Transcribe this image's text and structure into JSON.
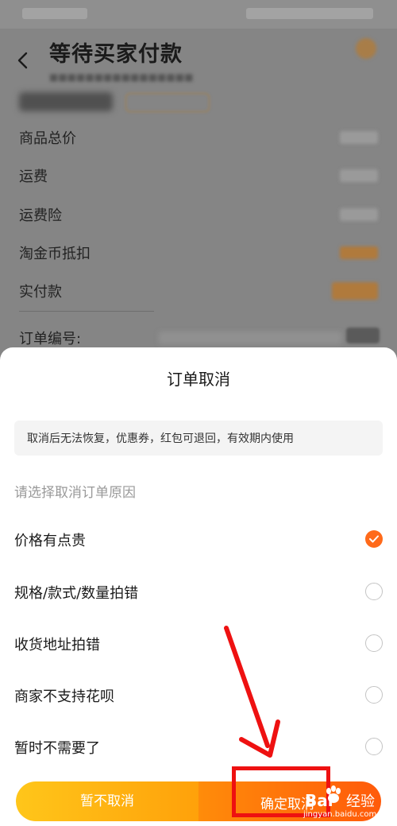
{
  "page": {
    "title": "等待买家付款"
  },
  "summary": {
    "rows": [
      "商品总价",
      "运费",
      "运费险",
      "淘金币抵扣",
      "实付款"
    ],
    "order_no_label": "订单编号:"
  },
  "sheet": {
    "title": "订单取消",
    "notice": "取消后无法恢复，优惠券，红包可退回，有效期内使用",
    "reason_prompt": "请选择取消订单原因",
    "reasons": [
      {
        "label": "价格有点贵",
        "checked": true
      },
      {
        "label": "规格/款式/数量拍错",
        "checked": false
      },
      {
        "label": "收货地址拍错",
        "checked": false
      },
      {
        "label": "商家不支持花呗",
        "checked": false
      },
      {
        "label": "暂时不需要了",
        "checked": false
      }
    ],
    "keep_label": "暂不取消",
    "confirm_label": "确定取消"
  },
  "watermark": {
    "logo": "Bai",
    "brand": "经验",
    "url": "jingyan.baidu.com"
  },
  "colors": {
    "accent": "#ff6a1a",
    "annotation": "#ee1111"
  }
}
